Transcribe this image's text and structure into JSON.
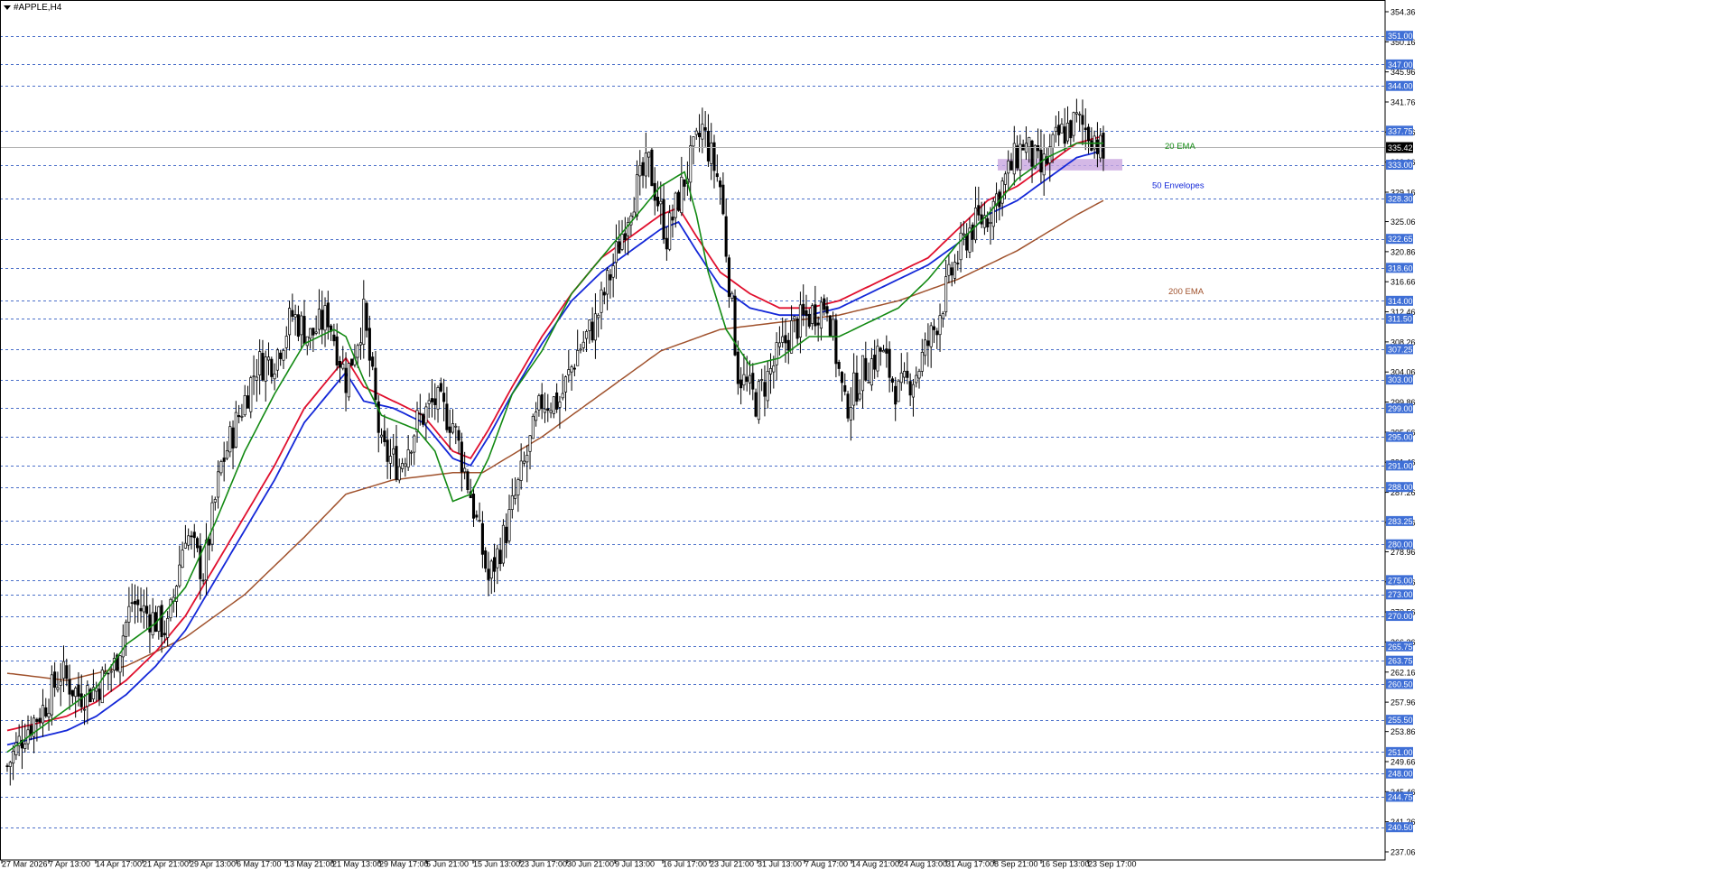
{
  "window": {
    "title": "#APPLE,H4"
  },
  "colors": {
    "grid_dashed": "#4a6fc9",
    "candle": "#000000",
    "ema20": "#138a13",
    "env_upper": "#e0102e",
    "env_lower": "#1428d8",
    "ema200": "#a0522d",
    "level_label_bg": "#3f6fd6",
    "current_price_bg": "#000000",
    "zone": "#c9a6e0"
  },
  "annotations": {
    "ema20_label": "20 EMA",
    "envelopes_label": "50 Envelopes",
    "ema200_label": "200 EMA"
  },
  "chart_data": {
    "type": "candlestick",
    "symbol": "#APPLE",
    "timeframe": "H4",
    "ylim": [
      237.06,
      354.36
    ],
    "current_price": 335.42,
    "price_axis_ticks": [
      "354.36",
      "350.16",
      "345.96",
      "341.76",
      "337.56",
      "333.36",
      "329.16",
      "325.06",
      "320.86",
      "316.66",
      "312.46",
      "308.26",
      "304.06",
      "299.86",
      "295.66",
      "291.46",
      "287.26",
      "283.06",
      "278.96",
      "274.76",
      "270.56",
      "266.36",
      "262.16",
      "257.96",
      "253.86",
      "249.66",
      "245.46",
      "241.26",
      "237.06"
    ],
    "horizontal_levels": [
      "351.00",
      "347.00",
      "344.00",
      "337.75",
      "333.00",
      "328.30",
      "322.65",
      "318.60",
      "314.00",
      "311.50",
      "307.25",
      "303.00",
      "299.00",
      "295.00",
      "291.00",
      "288.00",
      "283.25",
      "280.00",
      "275.00",
      "273.00",
      "270.00",
      "265.75",
      "263.75",
      "260.50",
      "255.50",
      "251.00",
      "248.00",
      "244.75",
      "240.50"
    ],
    "x_labels": [
      "27 Mar 2026",
      "7 Apr 13:00",
      "14 Apr 17:00",
      "21 Apr 21:00",
      "29 Apr 13:00",
      "6 May 17:00",
      "13 May 21:00",
      "21 May 13:00",
      "29 May 17:00",
      "5 Jun 21:00",
      "15 Jun 13:00",
      "23 Jun 17:00",
      "30 Jun 21:00",
      "9 Jul 13:00",
      "16 Jul 17:00",
      "23 Jul 21:00",
      "31 Jul 13:00",
      "7 Aug 17:00",
      "14 Aug 21:00",
      "24 Aug 13:00",
      "31 Aug 17:00",
      "8 Sep 21:00",
      "16 Sep 13:00",
      "23 Sep 17:00"
    ],
    "close_path": [
      [
        0,
        249
      ],
      [
        6,
        254
      ],
      [
        12,
        257
      ],
      [
        18,
        262
      ],
      [
        24,
        259
      ],
      [
        30,
        260
      ],
      [
        36,
        263
      ],
      [
        42,
        272
      ],
      [
        48,
        270
      ],
      [
        54,
        268
      ],
      [
        60,
        282
      ],
      [
        66,
        276
      ],
      [
        72,
        291
      ],
      [
        78,
        298
      ],
      [
        84,
        305
      ],
      [
        90,
        306
      ],
      [
        96,
        312
      ],
      [
        102,
        309
      ],
      [
        108,
        312
      ],
      [
        114,
        303
      ],
      [
        120,
        312
      ],
      [
        126,
        293
      ],
      [
        132,
        291
      ],
      [
        138,
        297
      ],
      [
        144,
        300
      ],
      [
        150,
        297
      ],
      [
        156,
        287
      ],
      [
        162,
        275
      ],
      [
        168,
        282
      ],
      [
        174,
        291
      ],
      [
        180,
        300
      ],
      [
        186,
        300
      ],
      [
        192,
        307
      ],
      [
        198,
        311
      ],
      [
        204,
        319
      ],
      [
        210,
        328
      ],
      [
        216,
        333
      ],
      [
        222,
        323
      ],
      [
        228,
        331
      ],
      [
        234,
        338
      ],
      [
        240,
        330
      ],
      [
        246,
        304
      ],
      [
        252,
        300
      ],
      [
        258,
        305
      ],
      [
        264,
        310
      ],
      [
        270,
        312
      ],
      [
        276,
        314
      ],
      [
        282,
        299
      ],
      [
        288,
        304
      ],
      [
        294,
        307
      ],
      [
        300,
        301
      ],
      [
        306,
        304
      ],
      [
        312,
        310
      ],
      [
        318,
        318
      ],
      [
        324,
        324
      ],
      [
        330,
        326
      ],
      [
        336,
        331
      ],
      [
        342,
        336
      ],
      [
        348,
        332
      ],
      [
        354,
        337
      ],
      [
        360,
        339
      ],
      [
        366,
        337
      ],
      [
        369,
        334
      ]
    ],
    "ema20_path": [
      [
        0,
        251
      ],
      [
        10,
        254
      ],
      [
        20,
        257
      ],
      [
        30,
        260
      ],
      [
        40,
        266
      ],
      [
        50,
        269
      ],
      [
        60,
        274
      ],
      [
        70,
        283
      ],
      [
        80,
        293
      ],
      [
        90,
        301
      ],
      [
        100,
        308
      ],
      [
        110,
        310
      ],
      [
        114,
        309
      ],
      [
        120,
        303
      ],
      [
        126,
        298
      ],
      [
        132,
        297
      ],
      [
        138,
        296
      ],
      [
        144,
        293
      ],
      [
        150,
        286
      ],
      [
        156,
        287
      ],
      [
        162,
        292
      ],
      [
        170,
        301
      ],
      [
        180,
        307
      ],
      [
        190,
        315
      ],
      [
        200,
        320
      ],
      [
        210,
        325
      ],
      [
        220,
        330
      ],
      [
        228,
        332
      ],
      [
        232,
        326
      ],
      [
        236,
        318
      ],
      [
        242,
        310
      ],
      [
        250,
        305
      ],
      [
        260,
        306
      ],
      [
        270,
        309
      ],
      [
        280,
        309
      ],
      [
        290,
        311
      ],
      [
        300,
        313
      ],
      [
        310,
        317
      ],
      [
        320,
        322
      ],
      [
        330,
        326
      ],
      [
        340,
        331
      ],
      [
        350,
        334
      ],
      [
        360,
        336
      ],
      [
        369,
        336
      ]
    ],
    "env_upper_path": [
      [
        0,
        254
      ],
      [
        10,
        255
      ],
      [
        20,
        256
      ],
      [
        30,
        258
      ],
      [
        40,
        261
      ],
      [
        50,
        265
      ],
      [
        60,
        270
      ],
      [
        70,
        277
      ],
      [
        80,
        284
      ],
      [
        90,
        291
      ],
      [
        100,
        299
      ],
      [
        110,
        304
      ],
      [
        114,
        306
      ],
      [
        120,
        302
      ],
      [
        130,
        300
      ],
      [
        140,
        298
      ],
      [
        150,
        293
      ],
      [
        156,
        292
      ],
      [
        162,
        296
      ],
      [
        170,
        302
      ],
      [
        180,
        309
      ],
      [
        190,
        315
      ],
      [
        200,
        320
      ],
      [
        210,
        323
      ],
      [
        220,
        326
      ],
      [
        226,
        327
      ],
      [
        232,
        323
      ],
      [
        240,
        318
      ],
      [
        250,
        315
      ],
      [
        260,
        313
      ],
      [
        270,
        313
      ],
      [
        280,
        314
      ],
      [
        290,
        316
      ],
      [
        300,
        318
      ],
      [
        310,
        320
      ],
      [
        320,
        324
      ],
      [
        330,
        328
      ],
      [
        340,
        330
      ],
      [
        350,
        333
      ],
      [
        360,
        336
      ],
      [
        369,
        337
      ]
    ],
    "env_lower_path": [
      [
        0,
        252
      ],
      [
        10,
        253
      ],
      [
        20,
        254
      ],
      [
        30,
        256
      ],
      [
        40,
        259
      ],
      [
        50,
        263
      ],
      [
        60,
        268
      ],
      [
        70,
        275
      ],
      [
        80,
        282
      ],
      [
        90,
        289
      ],
      [
        100,
        297
      ],
      [
        110,
        302
      ],
      [
        114,
        304
      ],
      [
        120,
        300
      ],
      [
        130,
        299
      ],
      [
        140,
        297
      ],
      [
        150,
        292
      ],
      [
        156,
        291
      ],
      [
        162,
        295
      ],
      [
        170,
        301
      ],
      [
        180,
        308
      ],
      [
        190,
        314
      ],
      [
        200,
        318
      ],
      [
        210,
        321
      ],
      [
        220,
        324
      ],
      [
        226,
        325
      ],
      [
        232,
        321
      ],
      [
        240,
        316
      ],
      [
        250,
        313
      ],
      [
        260,
        312
      ],
      [
        270,
        312
      ],
      [
        280,
        313
      ],
      [
        290,
        315
      ],
      [
        300,
        317
      ],
      [
        310,
        319
      ],
      [
        320,
        322
      ],
      [
        330,
        326
      ],
      [
        340,
        328
      ],
      [
        350,
        331
      ],
      [
        360,
        334
      ],
      [
        369,
        335
      ]
    ],
    "ema200_path": [
      [
        0,
        262
      ],
      [
        20,
        261
      ],
      [
        40,
        263
      ],
      [
        60,
        267
      ],
      [
        80,
        273
      ],
      [
        100,
        281
      ],
      [
        114,
        287
      ],
      [
        130,
        289
      ],
      [
        150,
        290
      ],
      [
        160,
        290
      ],
      [
        180,
        295
      ],
      [
        200,
        301
      ],
      [
        220,
        307
      ],
      [
        240,
        310
      ],
      [
        260,
        311
      ],
      [
        280,
        312
      ],
      [
        300,
        314
      ],
      [
        320,
        317
      ],
      [
        340,
        321
      ],
      [
        360,
        326
      ],
      [
        369,
        328
      ]
    ],
    "resistance_zone": [
      332.2,
      333.8
    ]
  }
}
